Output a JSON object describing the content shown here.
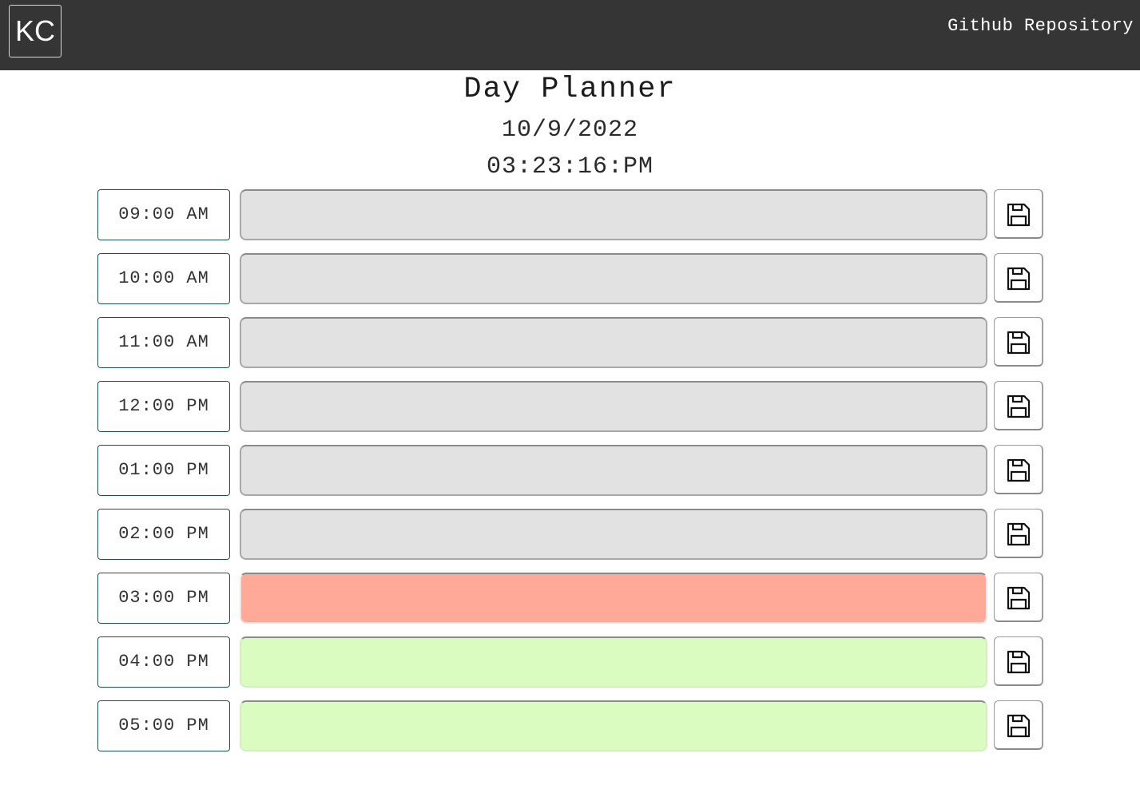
{
  "navbar": {
    "logo": "KC",
    "repo_link": "Github Repository"
  },
  "header": {
    "title": "Day Planner",
    "date": "10/9/2022",
    "time": "03:23:16:PM"
  },
  "colors": {
    "navbar": "#353535",
    "past": "#e2e2e2",
    "present": "#ffa998",
    "future": "#dbfcc1"
  },
  "schedule": [
    {
      "hour": "09:00 AM",
      "status": "past",
      "task": ""
    },
    {
      "hour": "10:00 AM",
      "status": "past",
      "task": ""
    },
    {
      "hour": "11:00 AM",
      "status": "past",
      "task": ""
    },
    {
      "hour": "12:00 PM",
      "status": "past",
      "task": ""
    },
    {
      "hour": "01:00 PM",
      "status": "past",
      "task": ""
    },
    {
      "hour": "02:00 PM",
      "status": "past",
      "task": ""
    },
    {
      "hour": "03:00 PM",
      "status": "present",
      "task": ""
    },
    {
      "hour": "04:00 PM",
      "status": "future",
      "task": ""
    },
    {
      "hour": "05:00 PM",
      "status": "future",
      "task": ""
    }
  ],
  "save_icon": "floppy-disk-icon"
}
